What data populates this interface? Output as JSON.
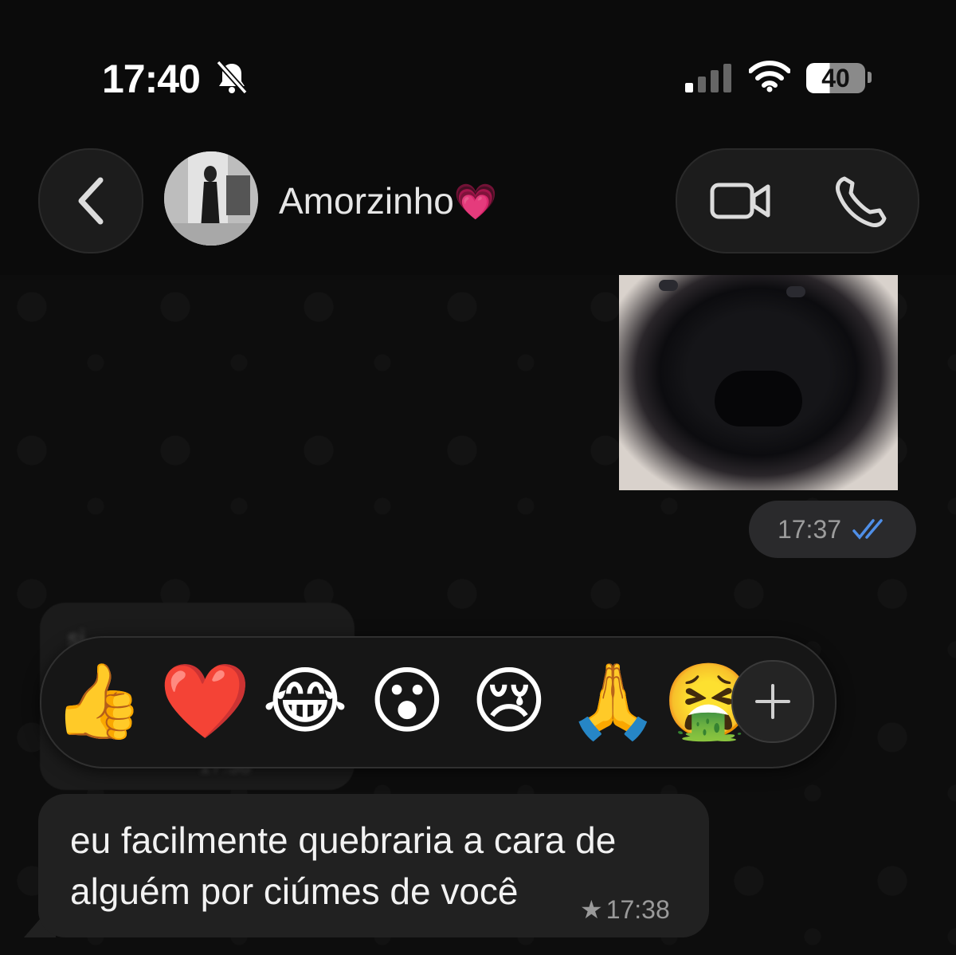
{
  "status_bar": {
    "time": "17:40",
    "battery": "40"
  },
  "header": {
    "contact_name": "Amorzinho",
    "contact_emoji": "💗"
  },
  "messages": [
    {
      "type": "sent-image",
      "time": "17:37",
      "status": "read"
    },
    {
      "type": "received-text",
      "text": "eu facilmente quebraria a cara de alguém por ciúmes de você",
      "time": "17:38",
      "starred": true,
      "star_glyph": "★"
    }
  ],
  "blurred_message": {
    "text": "si",
    "time": "17:38"
  },
  "reactions": [
    "👍",
    "❤️",
    "😂",
    "😮",
    "😢",
    "🙏",
    "🤮"
  ],
  "more_reactions_label": "+",
  "colors": {
    "read_check": "#4f8fe8",
    "bubble": "#212121",
    "background": "#0d0d0d"
  }
}
